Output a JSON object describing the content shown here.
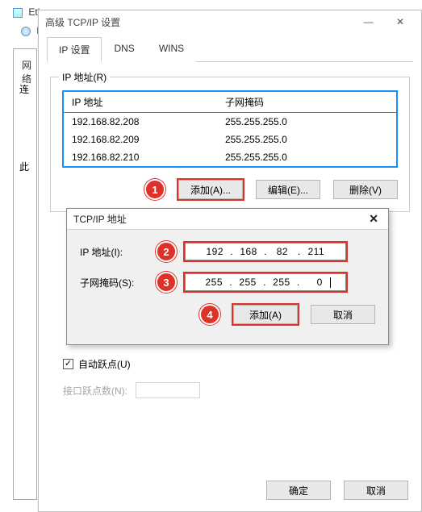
{
  "bg": {
    "eth1": "Ethern",
    "eth2": "Eth",
    "net_frag": "网络",
    "n_frag": "N",
    "lian_frag": "连",
    "ci_frag": "此"
  },
  "window": {
    "title": "高级 TCP/IP 设置",
    "min": "—",
    "close": "✕"
  },
  "tabs": [
    {
      "label": "IP 设置",
      "active": true
    },
    {
      "label": "DNS",
      "active": false
    },
    {
      "label": "WINS",
      "active": false
    }
  ],
  "ip_group": {
    "legend": "IP 地址(R)",
    "headers": {
      "ip": "IP 地址",
      "mask": "子网掩码"
    },
    "rows": [
      {
        "ip": "192.168.82.208",
        "mask": "255.255.255.0"
      },
      {
        "ip": "192.168.82.209",
        "mask": "255.255.255.0"
      },
      {
        "ip": "192.168.82.210",
        "mask": "255.255.255.0"
      }
    ],
    "buttons": {
      "add": "添加(A)...",
      "edit": "编辑(E)...",
      "remove": "删除(V)"
    }
  },
  "callouts": {
    "1": "1",
    "2": "2",
    "3": "3",
    "4": "4"
  },
  "subdialog": {
    "title": "TCP/IP 地址",
    "close": "✕",
    "ip_label": "IP 地址(I):",
    "mask_label": "子网掩码(S):",
    "ip_octets": [
      "192",
      "168",
      "82",
      "211"
    ],
    "mask_octets": [
      "255",
      "255",
      "255",
      "0"
    ],
    "add": "添加(A)",
    "cancel": "取消"
  },
  "auto": {
    "checkbox_label": "自动跃点(U)",
    "checked_glyph": "✓",
    "metric_label": "接口跃点数(N):"
  },
  "dialog_buttons": {
    "ok": "确定",
    "cancel": "取消"
  }
}
